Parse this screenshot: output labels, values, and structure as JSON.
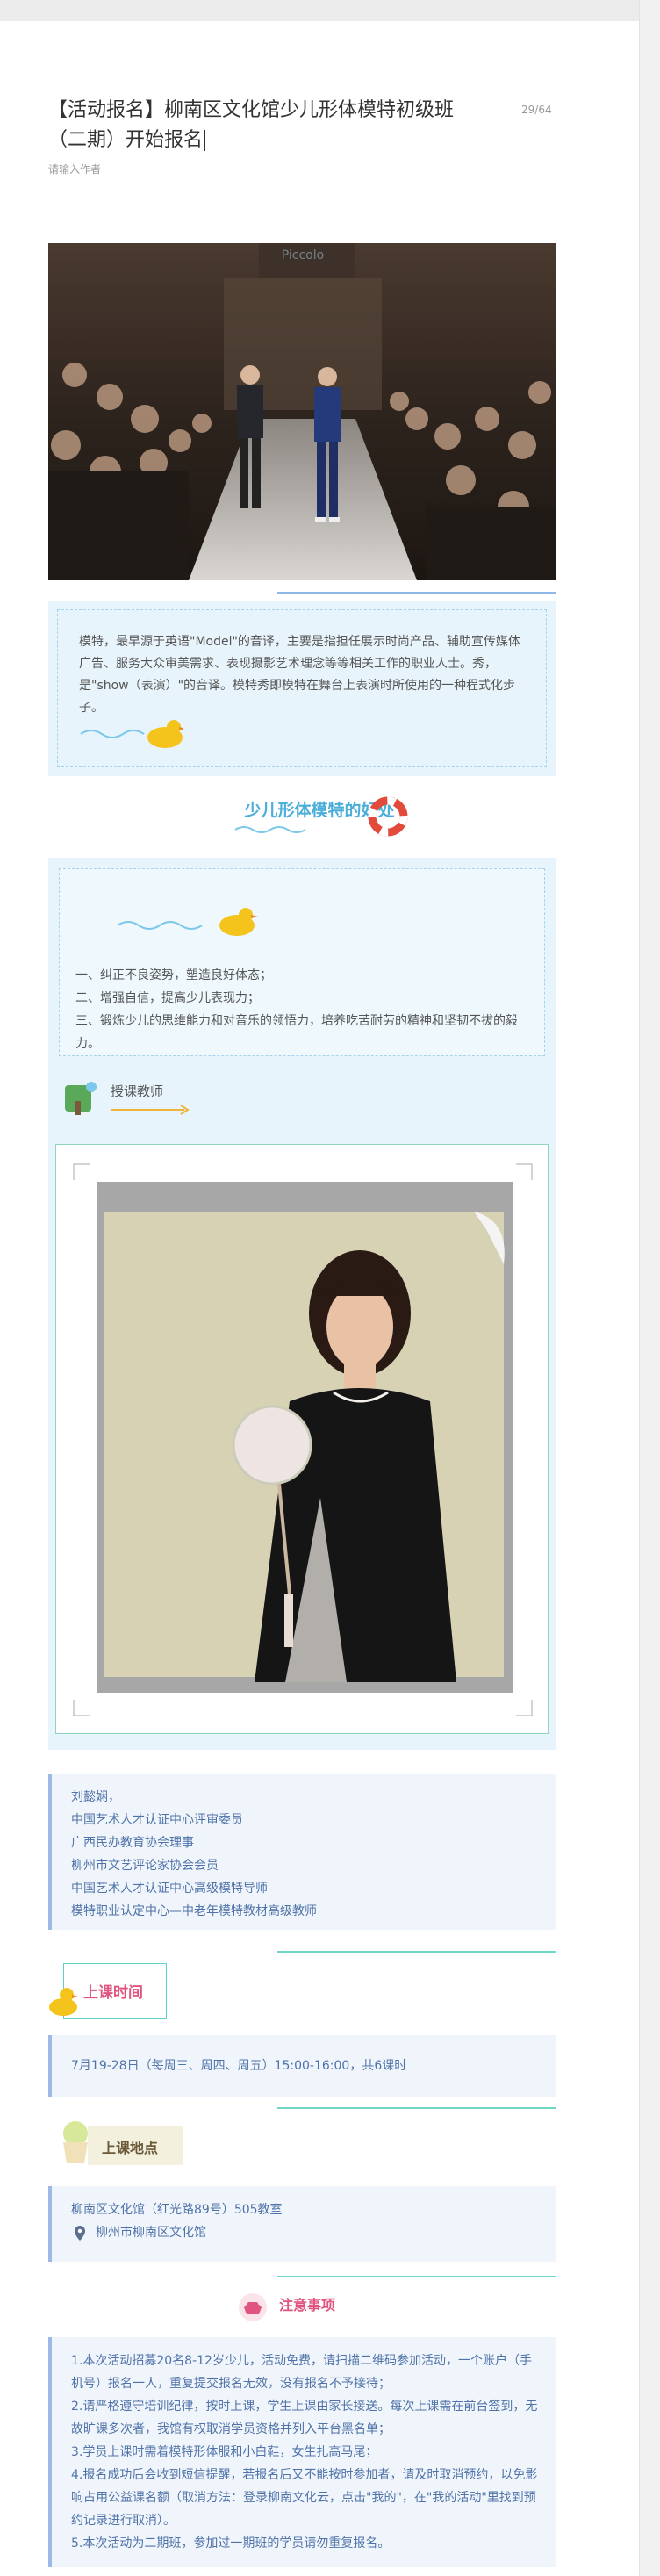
{
  "editor": {
    "title": "【活动报名】柳南区文化馆少儿形体模特初级班（二期）开始报名",
    "title_counter": "29/64",
    "author_placeholder": "请输入作者"
  },
  "intro": {
    "text": "模特，最早源于英语\"Model\"的音译，主要是指担任展示时尚产品、辅助宣传媒体广告、服务大众审美需求、表现摄影艺术理念等等相关工作的职业人士。秀，是\"show（表演）\"的音译。模特秀即模特在舞台上表演时所使用的一种程式化步子。"
  },
  "benefits": {
    "heading": "少儿形体模特的好处",
    "items": [
      "一、纠正不良姿势，塑造良好体态；",
      "二、增强自信，提高少儿表现力；",
      "三、锻炼少儿的思维能力和对音乐的领悟力，培养吃苦耐劳的精神和坚韧不拔的毅力。"
    ]
  },
  "teacher": {
    "label": "授课教师",
    "name": "刘懿娴，",
    "titles": [
      "中国艺术人才认证中心评审委员",
      "广西民办教育协会理事",
      "柳州市文艺评论家协会会员",
      "中国艺术人才认证中心高级模特导师",
      "模特职业认定中心—中老年模特教材高级教师"
    ]
  },
  "schedule": {
    "label": "上课时间",
    "text": "7月19-28日（每周三、周四、周五）15:00-16:00，共6课时"
  },
  "location": {
    "label": "上课地点",
    "address": "柳南区文化馆（红光路89号）505教室",
    "map_pin_text": "柳州市柳南区文化馆"
  },
  "notes": {
    "label": "注意事项",
    "items": [
      "1.本次活动招募20名8-12岁少儿，活动免费，请扫描二维码参加活动，一个账户（手机号）报名一人，重复提交报名无效，没有报名不予接待；",
      "2.请严格遵守培训纪律，按时上课，学生上课由家长接送。每次上课需在前台签到，无故旷课多次者，我馆有权取消学员资格并列入平台黑名单；",
      "3.学员上课时需着模特形体服和小白鞋，女生扎高马尾；",
      "4.报名成功后会收到短信提醒，若报名后又不能按时参加者，请及时取消预约，以免影响占用公益课名额（取消方法：登录柳南文化云，点击\"我的\"，在\"我的活动\"里找到预约记录进行取消）。",
      "5.本次活动为二期班，参加过一期班的学员请勿重复报名。"
    ]
  },
  "colors": {
    "accent_blue": "#4aaed9",
    "accent_pink": "#e0557f",
    "card_text": "#4f73a8",
    "panel_bg": "#e8f4fb"
  }
}
